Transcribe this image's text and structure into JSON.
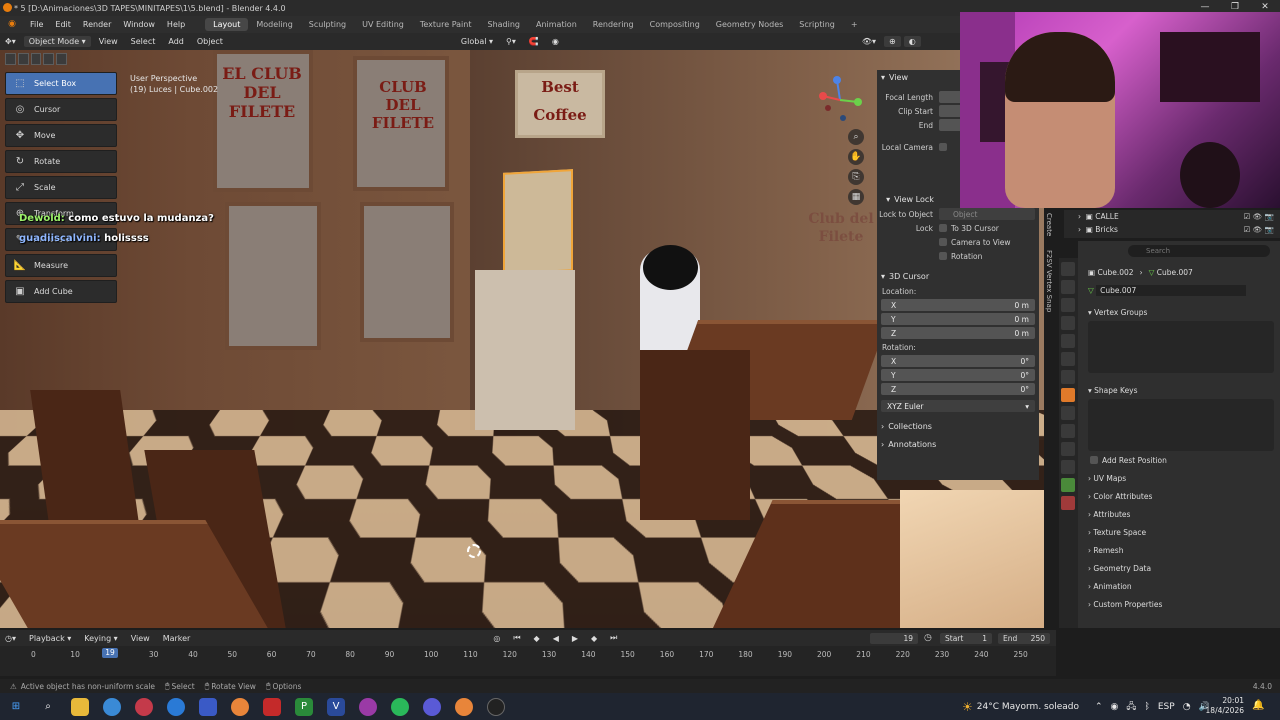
{
  "window": {
    "title": "* 5 [D:\\Animaciones\\3D TAPES\\MINITAPES\\1\\5.blend] - Blender 4.4.0",
    "controls": [
      "—",
      "❐",
      "✕"
    ]
  },
  "menu": {
    "items": [
      "File",
      "Edit",
      "Render",
      "Window",
      "Help"
    ],
    "workspaces": [
      "Layout",
      "Modeling",
      "Sculpting",
      "UV Editing",
      "Texture Paint",
      "Shading",
      "Animation",
      "Rendering",
      "Compositing",
      "Geometry Nodes",
      "Scripting"
    ],
    "active_workspace": "Layout",
    "add_tab": "+"
  },
  "viewport_header": {
    "mode": "Object Mode",
    "menus": [
      "View",
      "Select",
      "Add",
      "Object"
    ],
    "transform": "Global"
  },
  "toolbar": {
    "tools": [
      {
        "label": "Select Box",
        "icon": "select-box-icon",
        "glyph": "⬚",
        "active": true
      },
      {
        "label": "Cursor",
        "icon": "cursor-icon",
        "glyph": "◎",
        "active": false
      },
      {
        "label": "Move",
        "icon": "move-icon",
        "glyph": "✥",
        "active": false
      },
      {
        "label": "Rotate",
        "icon": "rotate-icon",
        "glyph": "↻",
        "active": false
      },
      {
        "label": "Scale",
        "icon": "scale-icon",
        "glyph": "⤢",
        "active": false
      },
      {
        "label": "Transform",
        "icon": "transform-icon",
        "glyph": "⊕",
        "active": false
      },
      {
        "label": "Annotate",
        "icon": "annotate-icon",
        "glyph": "✎",
        "active": false
      },
      {
        "label": "Measure",
        "icon": "measure-icon",
        "glyph": "📐",
        "active": false
      },
      {
        "label": "Add Cube",
        "icon": "add-cube-icon",
        "glyph": "▣",
        "active": false
      }
    ]
  },
  "viewport_info": {
    "line1": "User Perspective",
    "line2": "(19) Luces | Cube.002"
  },
  "scene_signs": {
    "sign1": "EL CLUB DEL FILETE",
    "sign2": "CLUB DEL FILETE",
    "coffee": "Best Coffee",
    "sign3": "Club del Filete"
  },
  "chat": [
    {
      "user": "Dewold:",
      "message": "como estuvo la mudanza?"
    },
    {
      "user": "guadiiscalvini:",
      "message": "holissss"
    }
  ],
  "npanel": {
    "view_header": "View",
    "focal_length_label": "Focal Length",
    "clip_start_label": "Clip Start",
    "end_label": "End",
    "local_camera_label": "Local Camera",
    "view_lock_header": "View Lock",
    "lock_to_object_label": "Lock to Object",
    "lock_to_object_placeholder": "Object",
    "lock_label": "Lock",
    "lock_options": [
      "To 3D Cursor",
      "Camera to View",
      "Rotation"
    ],
    "cursor_header": "3D Cursor",
    "location_label": "Location:",
    "location": [
      {
        "axis": "X",
        "value": "0 m"
      },
      {
        "axis": "Y",
        "value": "0 m"
      },
      {
        "axis": "Z",
        "value": "0 m"
      }
    ],
    "rotation_label": "Rotation:",
    "rotation": [
      {
        "axis": "X",
        "value": "0°"
      },
      {
        "axis": "Y",
        "value": "0°"
      },
      {
        "axis": "Z",
        "value": "0°"
      }
    ],
    "rotation_mode": "XYZ Euler",
    "collections_label": "Collections",
    "annotations_label": "Annotations",
    "side_tabs": [
      "Create",
      "F2SV Vertex Snap"
    ]
  },
  "outliner": {
    "rows": [
      {
        "name": "CALLE"
      },
      {
        "name": "Bricks"
      }
    ]
  },
  "properties": {
    "search_placeholder": "Search",
    "breadcrumb_object": "Cube.002",
    "breadcrumb_sep": "›",
    "breadcrumb_mesh": "Cube.007",
    "data_name": "Cube.007",
    "vertex_groups": "Vertex Groups",
    "shape_keys": "Shape Keys",
    "add_rest_position": "Add Rest Position",
    "sections": [
      "UV Maps",
      "Color Attributes",
      "Attributes",
      "Texture Space",
      "Remesh",
      "Geometry Data",
      "Animation",
      "Custom Properties"
    ]
  },
  "timeline": {
    "menus": [
      "Playback",
      "Keying",
      "View",
      "Marker"
    ],
    "current_frame": "19",
    "start_label": "Start",
    "start": "1",
    "end_label": "End",
    "end": "250",
    "ticks": [
      "0",
      "10",
      "19",
      "30",
      "40",
      "50",
      "60",
      "70",
      "80",
      "90",
      "100",
      "110",
      "120",
      "130",
      "140",
      "150",
      "160",
      "170",
      "180",
      "190",
      "200",
      "210",
      "220",
      "230",
      "240",
      "250"
    ]
  },
  "statusbar": {
    "message": "Active object has non-uniform scale",
    "hints": [
      "Select",
      "Rotate View",
      "Options"
    ],
    "version": "4.4.0"
  },
  "taskbar": {
    "weather_temp": "24°C",
    "weather_text": "Mayorm. soleado",
    "lang": "ESP",
    "time": "20:01",
    "date": "18/4/2026"
  },
  "colors": {
    "accent": "#4772b3",
    "panel": "#303030",
    "header": "#2a2a2a"
  }
}
